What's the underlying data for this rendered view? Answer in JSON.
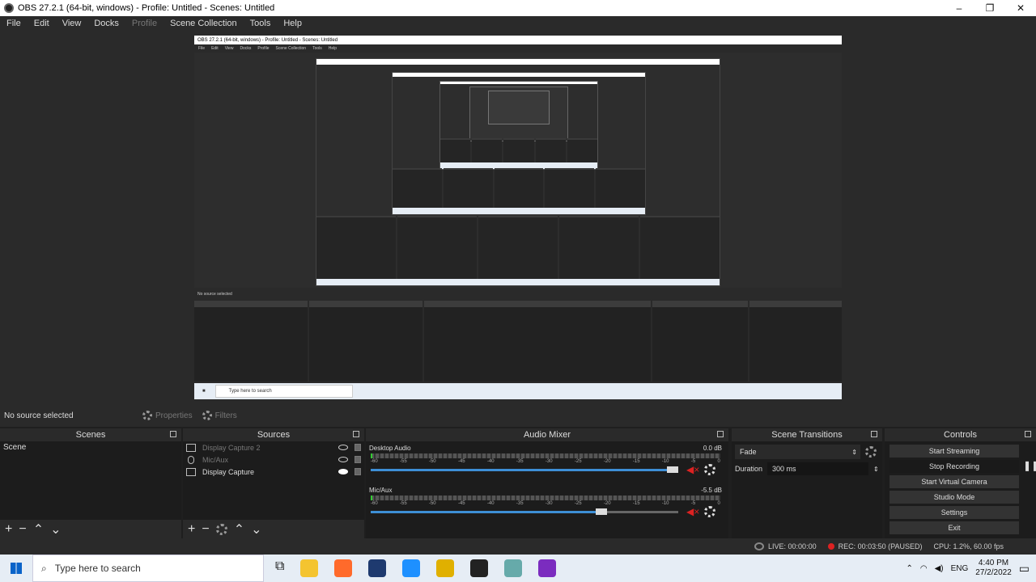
{
  "window": {
    "title": "OBS 27.2.1 (64-bit, windows) - Profile: Untitled - Scenes: Untitled",
    "controls": [
      "–",
      "❐",
      "✕"
    ]
  },
  "menu": [
    "File",
    "Edit",
    "View",
    "Docks",
    "Profile",
    "Scene Collection",
    "Tools",
    "Help"
  ],
  "menu_disabled": "Profile",
  "preview": {
    "nested_title": "OBS 27.2.1 (64-bit, windows) - Profile: Untitled - Scenes: Untitled",
    "nested_menu": [
      "File",
      "Edit",
      "View",
      "Docks",
      "Profile",
      "Scene Collection",
      "Tools",
      "Help"
    ],
    "nested_no_source": "No source selected",
    "nested_search": "Type here to search"
  },
  "source_toolbar": {
    "no_source": "No source selected",
    "properties": "Properties",
    "filters": "Filters"
  },
  "scenes": {
    "title": "Scenes",
    "items": [
      "Scene"
    ]
  },
  "sources": {
    "title": "Sources",
    "items": [
      {
        "label": "Display Capture 2",
        "visible": false
      },
      {
        "label": "Mic/Aux",
        "visible": false
      },
      {
        "label": "Display Capture",
        "visible": true
      }
    ]
  },
  "audio_mixer": {
    "title": "Audio Mixer",
    "scale": [
      "-60",
      "-55",
      "-50",
      "-45",
      "-40",
      "-35",
      "-30",
      "-25",
      "-20",
      "-15",
      "-10",
      "-5",
      "0"
    ],
    "channels": [
      {
        "name": "Desktop Audio",
        "db": "0.0 dB",
        "volume": 1.0
      },
      {
        "name": "Mic/Aux",
        "db": "-5.5 dB",
        "volume": 0.76
      }
    ]
  },
  "transitions": {
    "title": "Scene Transitions",
    "selected": "Fade",
    "duration_label": "Duration",
    "duration_value": "300 ms"
  },
  "controls": {
    "title": "Controls",
    "buttons": [
      "Start Streaming",
      "Stop Recording",
      "Start Virtual Camera",
      "Studio Mode",
      "Settings",
      "Exit"
    ]
  },
  "status": {
    "live": "LIVE: 00:00:00",
    "rec": "REC: 00:03:50 (PAUSED)",
    "cpu": "CPU: 1.2%, 60.00 fps"
  },
  "taskbar": {
    "search_placeholder": "Type here to search",
    "lang": "ENG",
    "time": "4:40 PM",
    "date": "27/2/2022",
    "apps": [
      "#f4c430",
      "#ff6a2b",
      "#1e3a6f",
      "#1e90ff",
      "#e0b000",
      "#222222",
      "#6aa",
      "#7b2cbf"
    ]
  }
}
